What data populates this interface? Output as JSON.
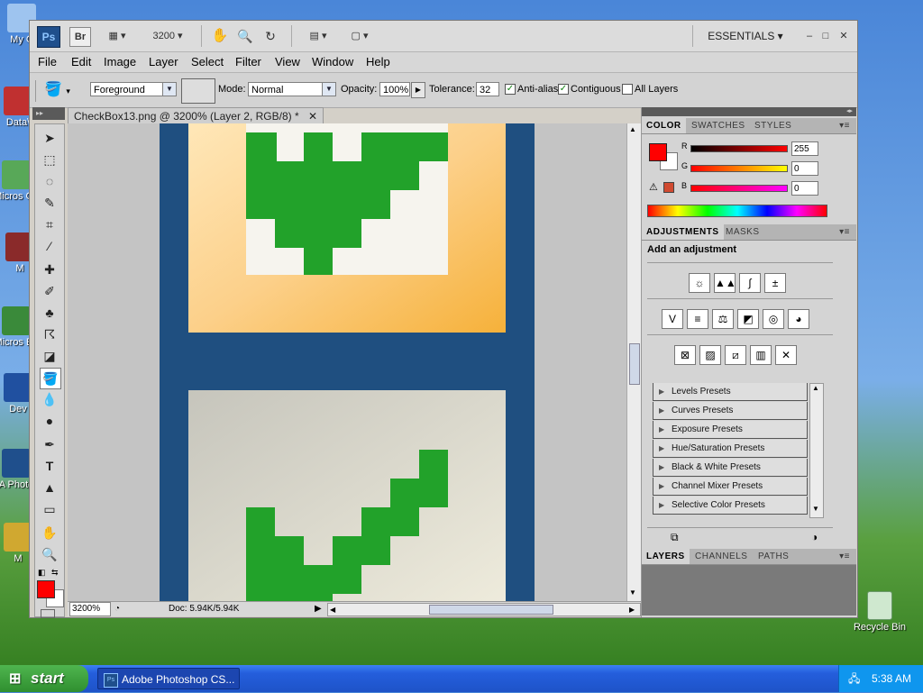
{
  "desktop": {
    "icons": [
      "My C",
      "Data\\",
      "Micros C+",
      "M",
      "Micros Ba",
      "Dev",
      "A Photo",
      "M"
    ],
    "recycle_bin": "Recycle Bin"
  },
  "appbar": {
    "logo": "Ps",
    "bridge": "Br",
    "zoom": "3200",
    "workspace": "ESSENTIALS",
    "win_controls": [
      "–",
      "□",
      "✕"
    ]
  },
  "menu": [
    "File",
    "Edit",
    "Image",
    "Layer",
    "Select",
    "Filter",
    "View",
    "Window",
    "Help"
  ],
  "options": {
    "fill_source": "Foreground",
    "mode_label": "Mode:",
    "mode": "Normal",
    "opacity_label": "Opacity:",
    "opacity": "100%",
    "tolerance_label": "Tolerance:",
    "tolerance": "32",
    "anti_alias": "Anti-alias",
    "contiguous": "Contiguous",
    "all_layers": "All Layers"
  },
  "document": {
    "tab_title": "CheckBox13.png @ 3200% (Layer 2, RGB/8) *",
    "zoom": "3200%",
    "doc_info": "Doc: 5.94K/5.94K"
  },
  "colors": {
    "foreground": "#ff0000",
    "background": "#ffffff",
    "canvas_blue": "#1f4f80",
    "check_green": "#22a22a",
    "orange": "#f9b73a"
  },
  "color_panel": {
    "tabs": [
      "COLOR",
      "SWATCHES",
      "STYLES"
    ],
    "r_label": "R",
    "r": "255",
    "g_label": "G",
    "g": "0",
    "b_label": "B",
    "b": "0"
  },
  "adjustments": {
    "tabs": [
      "ADJUSTMENTS",
      "MASKS"
    ],
    "heading": "Add an adjustment",
    "presets": [
      "Levels Presets",
      "Curves Presets",
      "Exposure Presets",
      "Hue/Saturation Presets",
      "Black & White Presets",
      "Channel Mixer Presets",
      "Selective Color Presets"
    ]
  },
  "layers_panel": {
    "tabs": [
      "LAYERS",
      "CHANNELS",
      "PATHS"
    ]
  },
  "taskbar": {
    "start": "start",
    "task": "Adobe Photoshop CS...",
    "time": "5:38 AM"
  }
}
